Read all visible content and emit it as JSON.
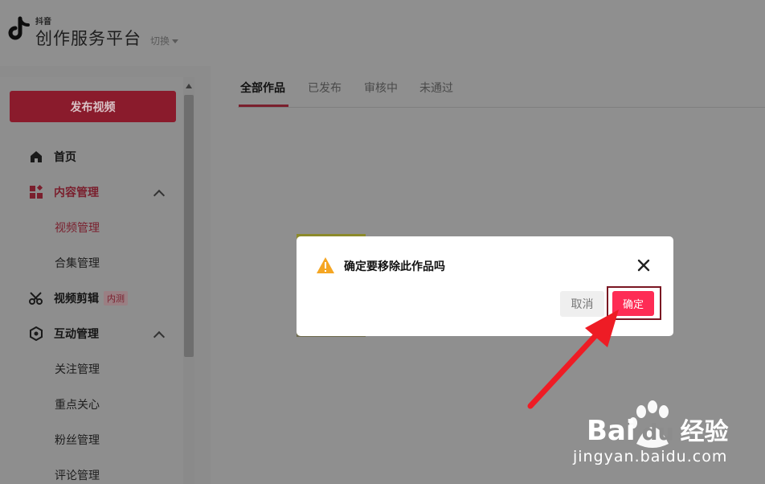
{
  "header": {
    "brand_small": "抖音",
    "brand_title": "创作服务平台",
    "switch_label": "切换"
  },
  "sidebar": {
    "publish_button": "发布视频",
    "items": [
      {
        "label": "首页",
        "icon": "home-icon"
      },
      {
        "label": "内容管理",
        "icon": "grid-icon",
        "expanded": true
      },
      {
        "label": "视频管理",
        "sub": true,
        "active": true
      },
      {
        "label": "合集管理",
        "sub": true
      },
      {
        "label": "视频剪辑",
        "icon": "scissors-icon",
        "badge": "内测"
      },
      {
        "label": "互动管理",
        "icon": "interaction-icon",
        "expanded": true
      },
      {
        "label": "关注管理",
        "sub": true
      },
      {
        "label": "重点关心",
        "sub": true
      },
      {
        "label": "粉丝管理",
        "sub": true
      },
      {
        "label": "评论管理",
        "sub": true
      }
    ]
  },
  "tabs": [
    {
      "label": "全部作品",
      "active": true
    },
    {
      "label": "已发布"
    },
    {
      "label": "审核中"
    },
    {
      "label": "未通过"
    }
  ],
  "dialog": {
    "title": "确定要移除此作品吗",
    "cancel_label": "取消",
    "confirm_label": "确定"
  },
  "watermark": {
    "brand": "Bai",
    "brand_du": "du",
    "suffix": "经验",
    "url": "jingyan.baidu.com"
  },
  "colors": {
    "accent": "#fe2c55",
    "highlight_box": "#7a1622",
    "arrow": "#ee1c25"
  }
}
